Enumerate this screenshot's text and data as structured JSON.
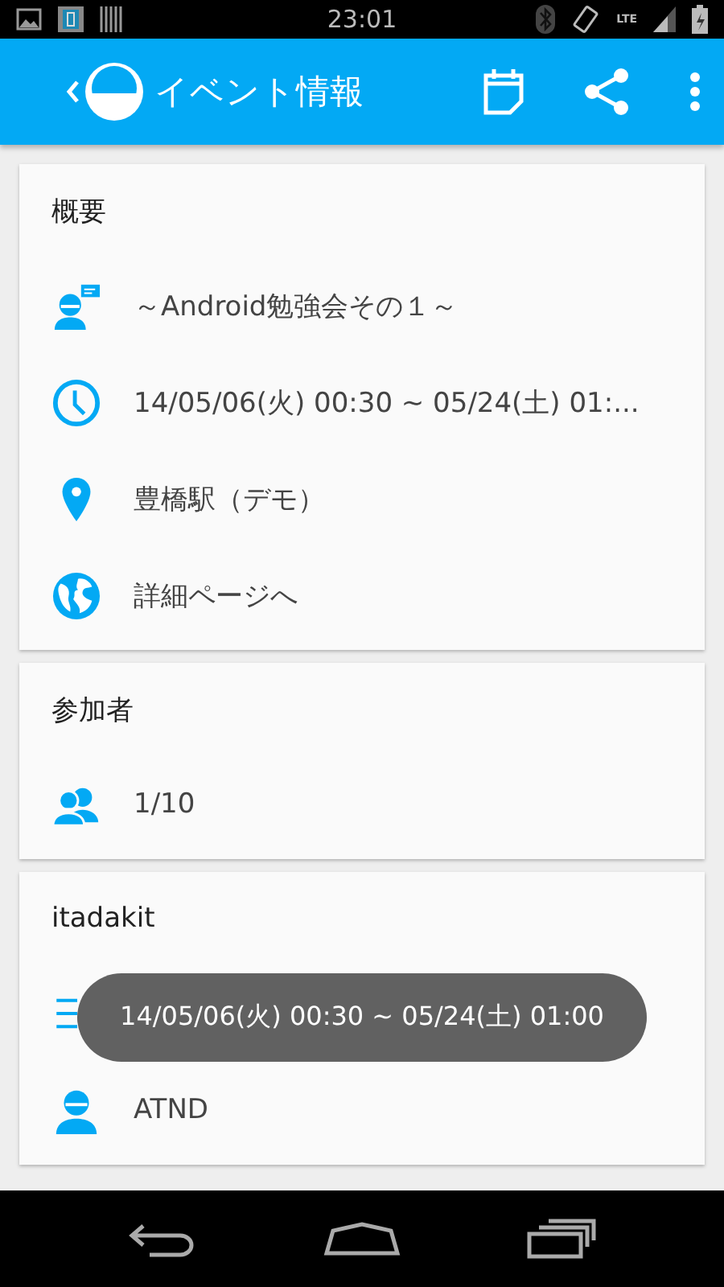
{
  "status_bar": {
    "time": "23:01",
    "network": "LTE"
  },
  "app_bar": {
    "title": "イベント情報"
  },
  "cards": [
    {
      "title": "概要",
      "rows": [
        {
          "kind": "speaker",
          "label": "～Android勉強会その１～"
        },
        {
          "kind": "time",
          "label": "14/05/06(火) 00:30 ~ 05/24(土) 01:..."
        },
        {
          "kind": "place",
          "label": "豊橋駅（デモ）"
        },
        {
          "kind": "link",
          "label": "詳細ページへ"
        }
      ]
    },
    {
      "title": "参加者",
      "rows": [
        {
          "kind": "people",
          "label": "1/10"
        }
      ]
    },
    {
      "title": "itadakit",
      "rows": [
        {
          "kind": "list"
        },
        {
          "kind": "person",
          "label": "ATND"
        }
      ]
    }
  ],
  "toast": {
    "text": "14/05/06(火) 00:30 ~ 05/24(土) 01:00"
  }
}
